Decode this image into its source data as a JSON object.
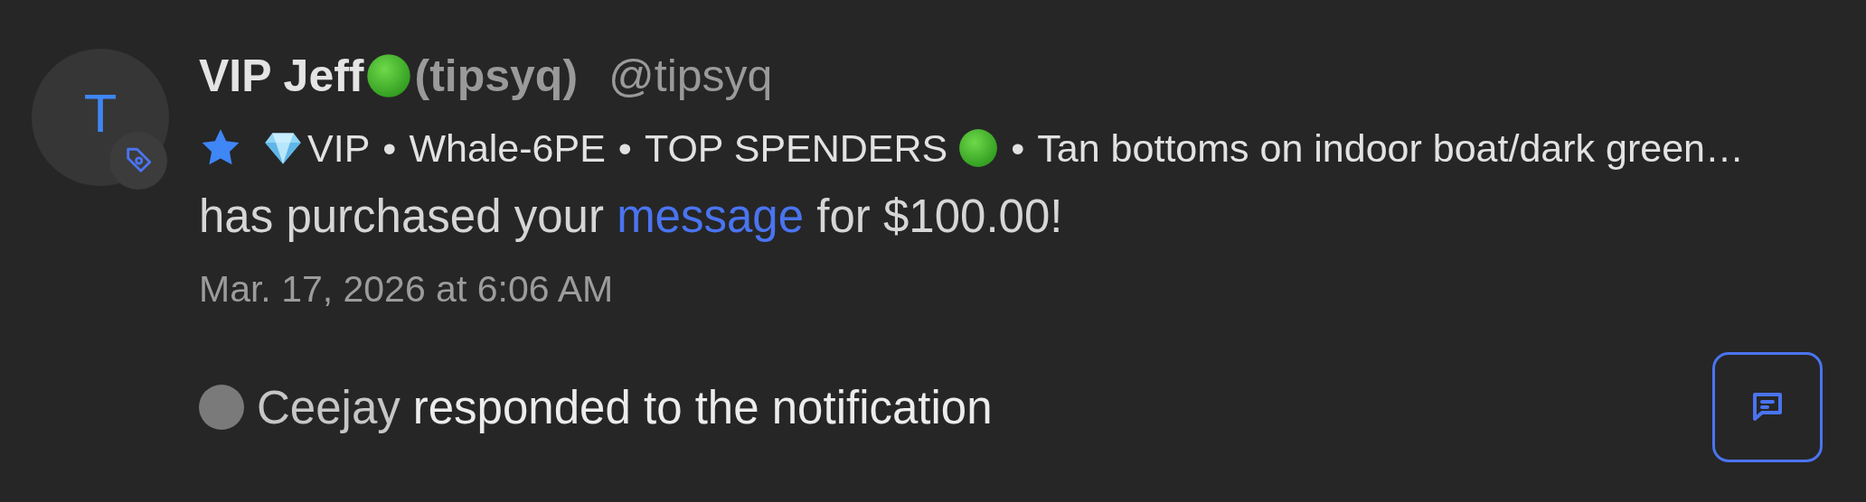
{
  "avatar": {
    "initial": "T"
  },
  "user": {
    "name": "VIP Jeff",
    "display": "(tipsyq)",
    "handle": "@tipsyq"
  },
  "tags": {
    "separator": "•",
    "items": [
      {
        "kind": "vip",
        "label": "VIP"
      },
      {
        "kind": "plain",
        "label": "Whale-6PE"
      },
      {
        "kind": "status",
        "label": "TOP SPENDERS"
      },
      {
        "kind": "plain",
        "label": "Tan bottoms on indoor boat/dark green…"
      }
    ]
  },
  "message": {
    "before": "has purchased your",
    "link": "message",
    "after": "for $100.00!"
  },
  "date": "Mar. 17, 2026 at 6:06 AM",
  "response": {
    "responder": "Ceejay",
    "text": "responded to the notification"
  }
}
